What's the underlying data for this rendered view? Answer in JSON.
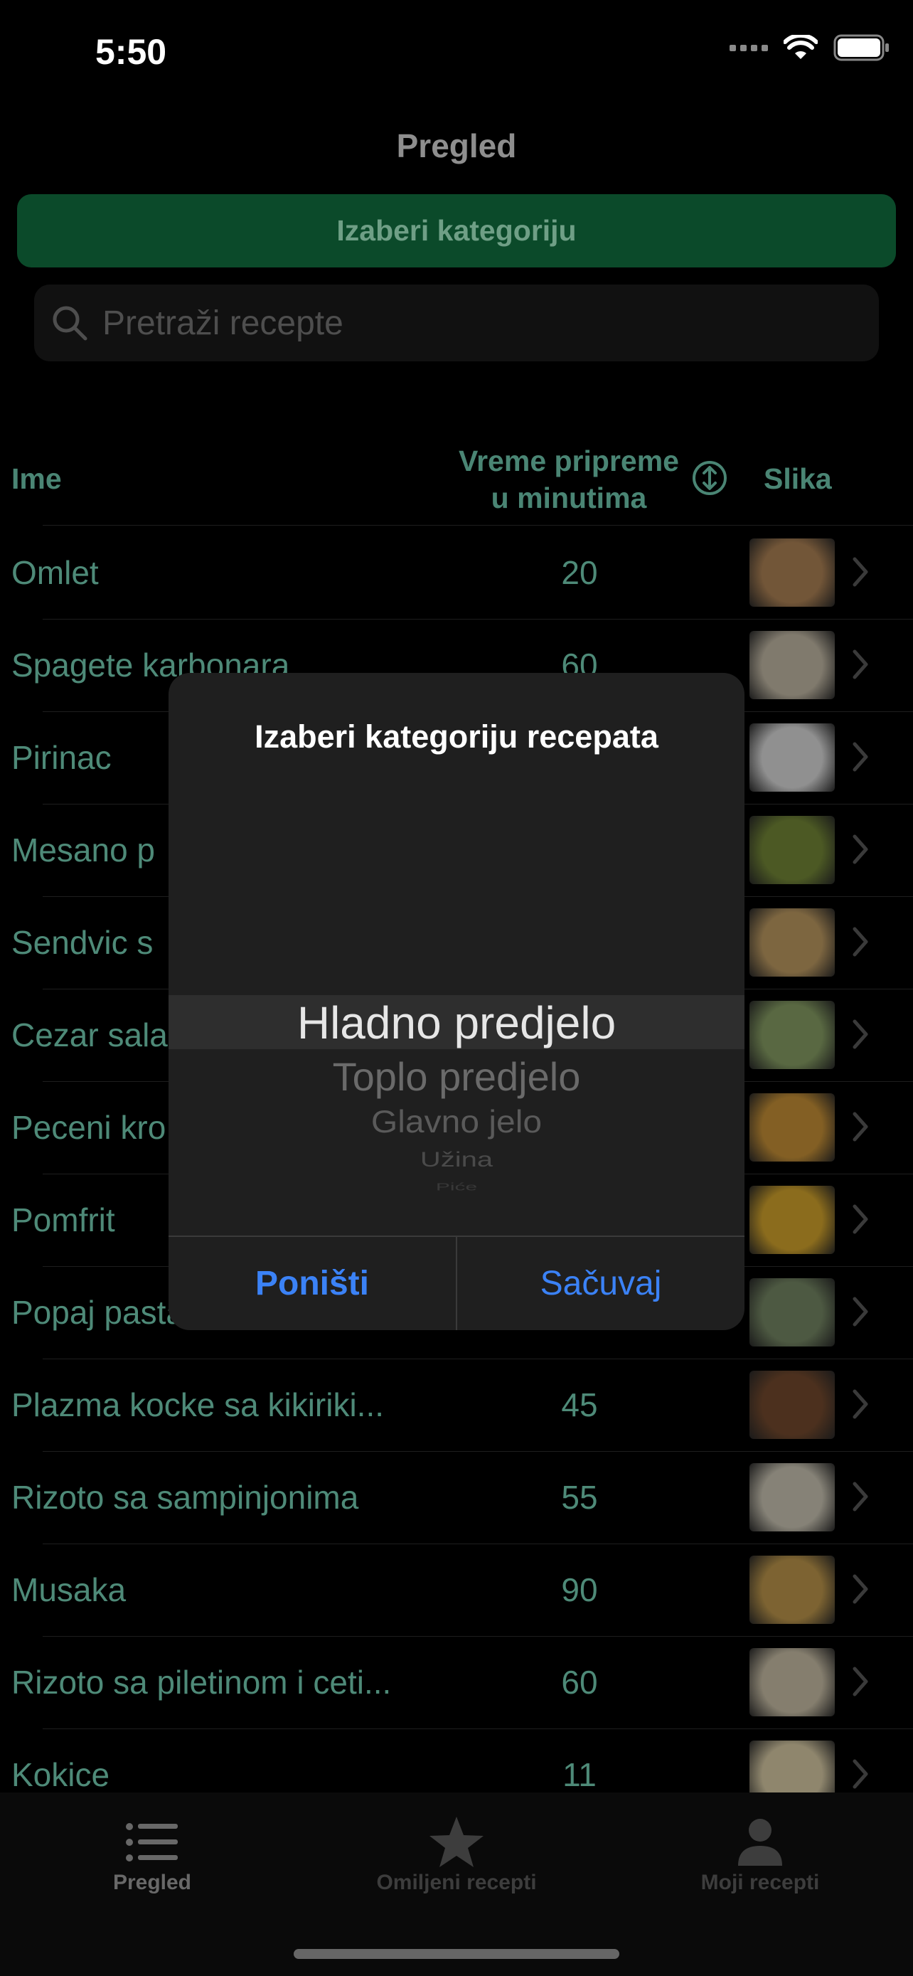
{
  "status_bar": {
    "time": "5:50"
  },
  "nav": {
    "title": "Pregled"
  },
  "category_button": {
    "label": "Izaberi kategoriju"
  },
  "search": {
    "placeholder": "Pretraži recepte"
  },
  "table": {
    "headers": {
      "name": "Ime",
      "prep_time_line1": "Vreme pripreme",
      "prep_time_line2": "u minutima",
      "image": "Slika"
    },
    "rows": [
      {
        "name": "Omlet",
        "minutes": "20",
        "thumb_color": "#b88a5a",
        "thumb_icon": "omelette-thumbnail"
      },
      {
        "name": "Spagete karbonara",
        "minutes": "60",
        "thumb_color": "#cfc5b0",
        "thumb_icon": "carbonara-thumbnail"
      },
      {
        "name": "Pirinac",
        "minutes": "",
        "thumb_color": "#e8e8e8",
        "thumb_icon": "rice-thumbnail"
      },
      {
        "name": "Mesano p",
        "minutes": "",
        "thumb_color": "#7a8f3a",
        "thumb_icon": "mixed-vegetables-thumbnail"
      },
      {
        "name": "Sendvic s",
        "minutes": "",
        "thumb_color": "#c9a468",
        "thumb_icon": "sandwich-thumbnail"
      },
      {
        "name": "Cezar sala",
        "minutes": "",
        "thumb_color": "#8fa86a",
        "thumb_icon": "caesar-salad-thumbnail"
      },
      {
        "name": "Peceni kro",
        "minutes": "",
        "thumb_color": "#d49a3a",
        "thumb_icon": "baked-potatoes-thumbnail"
      },
      {
        "name": "Pomfrit",
        "minutes": "",
        "thumb_color": "#e0ae2e",
        "thumb_icon": "fries-thumbnail"
      },
      {
        "name": "Popaj pasta",
        "minutes": "",
        "thumb_color": "#7c8f6a",
        "thumb_icon": "pasta-thumbnail"
      },
      {
        "name": "Plazma kocke sa kikiriki...",
        "minutes": "45",
        "thumb_color": "#7a4e30",
        "thumb_icon": "plazma-cubes-thumbnail"
      },
      {
        "name": "Rizoto sa sampinjonima",
        "minutes": "55",
        "thumb_color": "#d8d2c0",
        "thumb_icon": "mushroom-risotto-thumbnail"
      },
      {
        "name": "Musaka",
        "minutes": "90",
        "thumb_color": "#c9a050",
        "thumb_icon": "moussaka-thumbnail"
      },
      {
        "name": "Rizoto sa piletinom i ceti...",
        "minutes": "60",
        "thumb_color": "#d7ccb2",
        "thumb_icon": "chicken-risotto-thumbnail"
      },
      {
        "name": "Kokice",
        "minutes": "11",
        "thumb_color": "#e6d8b0",
        "thumb_icon": "popcorn-thumbnail"
      }
    ]
  },
  "tabs": [
    {
      "label": "Pregled",
      "icon": "list-icon"
    },
    {
      "label": "Omiljeni recepti",
      "icon": "star-icon"
    },
    {
      "label": "Moji recepti",
      "icon": "person-icon"
    }
  ],
  "modal": {
    "title": "Izaberi kategoriju recepata",
    "options": [
      "Hladno predjelo",
      "Toplo predjelo",
      "Glavno jelo",
      "Užina",
      "Piće"
    ],
    "selected": "Hladno predjelo",
    "cancel_label": "Poništi",
    "save_label": "Sačuvaj"
  },
  "colors": {
    "accent": "#0b4a2a",
    "link_blue": "#3b82f6",
    "header_text": "#4a8574"
  }
}
